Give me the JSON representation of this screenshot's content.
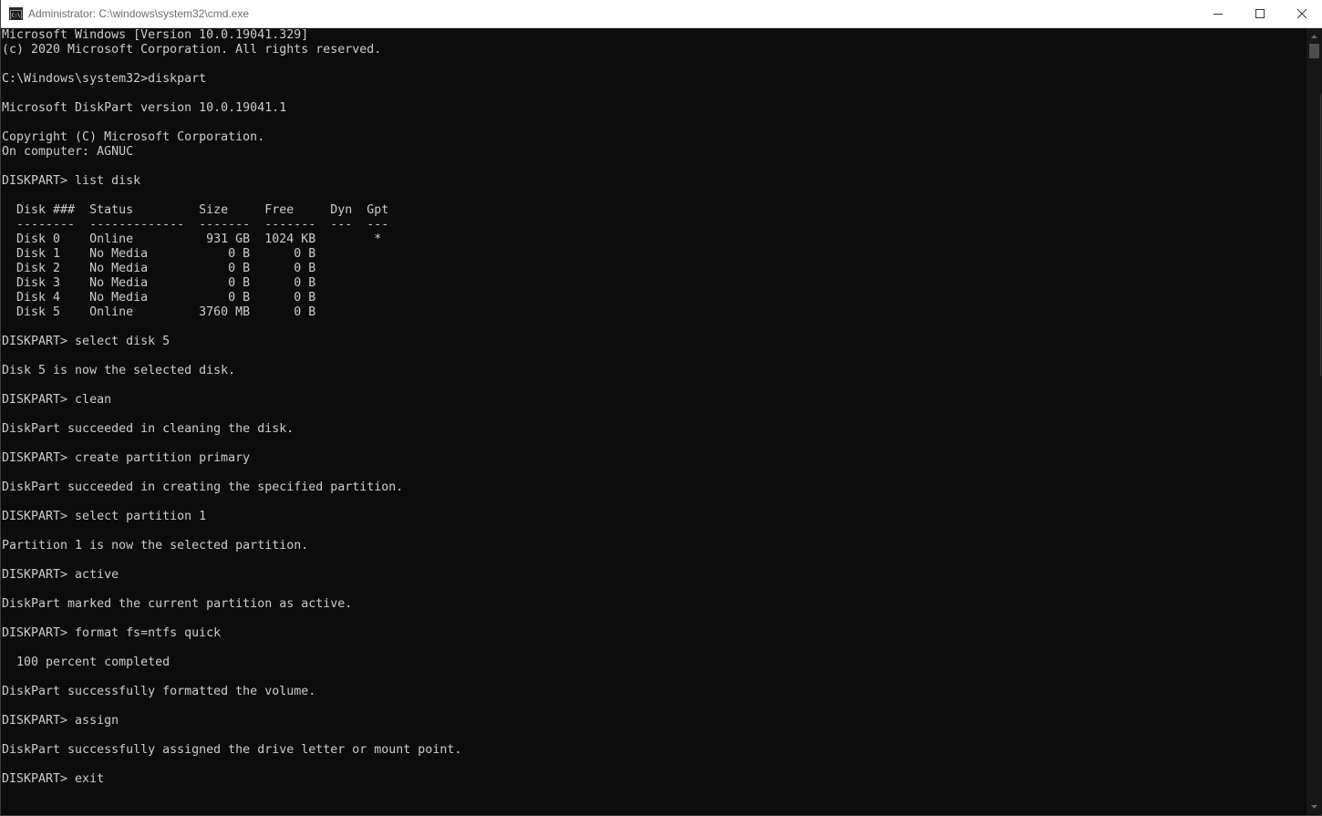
{
  "window": {
    "title": "Administrator: C:\\windows\\system32\\cmd.exe",
    "controls": {
      "minimize": "minimize-icon",
      "maximize": "maximize-icon",
      "close": "close-icon"
    }
  },
  "console": {
    "lines": [
      "Microsoft Windows [Version 10.0.19041.329]",
      "(c) 2020 Microsoft Corporation. All rights reserved.",
      "",
      "C:\\Windows\\system32>diskpart",
      "",
      "Microsoft DiskPart version 10.0.19041.1",
      "",
      "Copyright (C) Microsoft Corporation.",
      "On computer: AGNUC",
      "",
      "DISKPART> list disk",
      "",
      "  Disk ###  Status         Size     Free     Dyn  Gpt",
      "  --------  -------------  -------  -------  ---  ---",
      "  Disk 0    Online          931 GB  1024 KB        *",
      "  Disk 1    No Media           0 B      0 B",
      "  Disk 2    No Media           0 B      0 B",
      "  Disk 3    No Media           0 B      0 B",
      "  Disk 4    No Media           0 B      0 B",
      "  Disk 5    Online         3760 MB      0 B",
      "",
      "DISKPART> select disk 5",
      "",
      "Disk 5 is now the selected disk.",
      "",
      "DISKPART> clean",
      "",
      "DiskPart succeeded in cleaning the disk.",
      "",
      "DISKPART> create partition primary",
      "",
      "DiskPart succeeded in creating the specified partition.",
      "",
      "DISKPART> select partition 1",
      "",
      "Partition 1 is now the selected partition.",
      "",
      "DISKPART> active",
      "",
      "DiskPart marked the current partition as active.",
      "",
      "DISKPART> format fs=ntfs quick",
      "",
      "  100 percent completed",
      "",
      "DiskPart successfully formatted the volume.",
      "",
      "DISKPART> assign",
      "",
      "DiskPart successfully assigned the drive letter or mount point.",
      "",
      "DISKPART> exit"
    ]
  },
  "colors": {
    "background": "#0c0c0c",
    "text": "#cccccc",
    "titlebar": "#ffffff",
    "title_text": "#6e6e6e"
  }
}
